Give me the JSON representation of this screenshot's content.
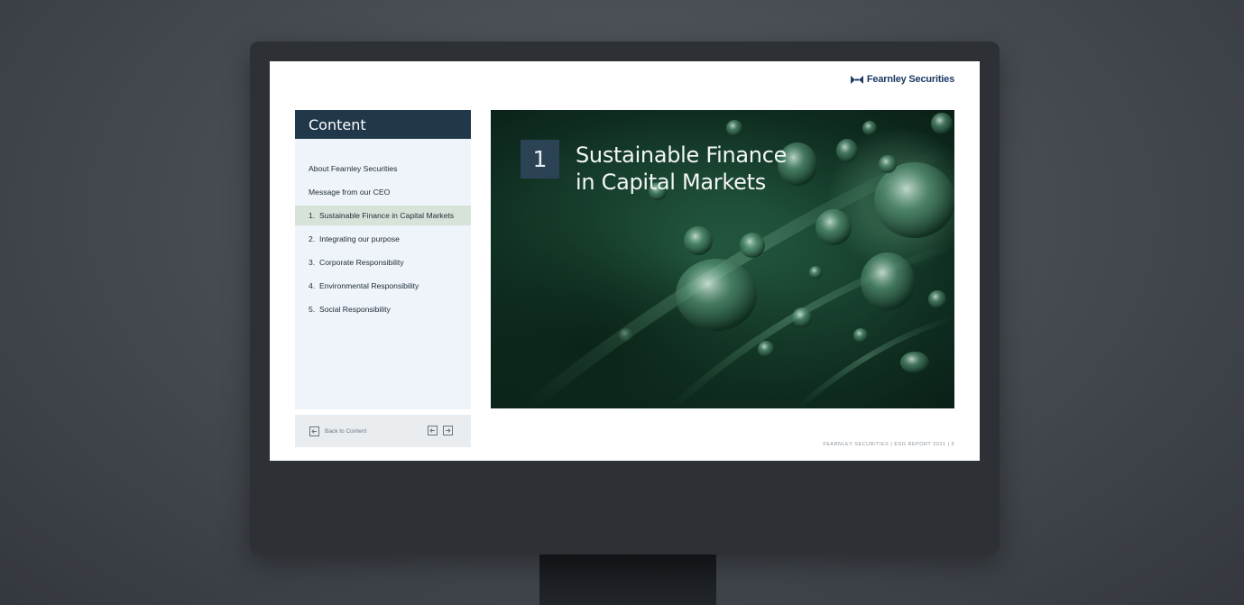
{
  "brand": {
    "name": "Fearnley Securities"
  },
  "toc": {
    "title": "Content",
    "items": [
      {
        "num": "",
        "label": "About Fearnley Securities",
        "active": false
      },
      {
        "num": "",
        "label": "Message from our CEO",
        "active": false
      },
      {
        "num": "1.",
        "label": "Sustainable Finance in Capital Markets",
        "active": true
      },
      {
        "num": "2.",
        "label": "Integrating our purpose",
        "active": false
      },
      {
        "num": "3.",
        "label": "Corporate Responsibility",
        "active": false
      },
      {
        "num": "4.",
        "label": "Environmental Responsibility",
        "active": false
      },
      {
        "num": "5.",
        "label": "Social Responsibility",
        "active": false
      }
    ],
    "back_label": "Back to Content"
  },
  "chapter": {
    "number": "1",
    "title_line1": "Sustainable Finance",
    "title_line2": "in Capital Markets"
  },
  "footer": {
    "text": "FEARNLEY SECURITIES  |  ESG REPORT 2021  |  5"
  },
  "colors": {
    "toc_header": "#21374a",
    "toc_active": "#d5e3d8",
    "chapter_box": "#2c4255",
    "brand": "#1d3b63"
  },
  "icons": {
    "back": "arrow-left-box-icon",
    "prev": "arrow-left-box-icon",
    "next": "arrow-right-box-icon",
    "logo": "fearnley-logo-mark"
  }
}
